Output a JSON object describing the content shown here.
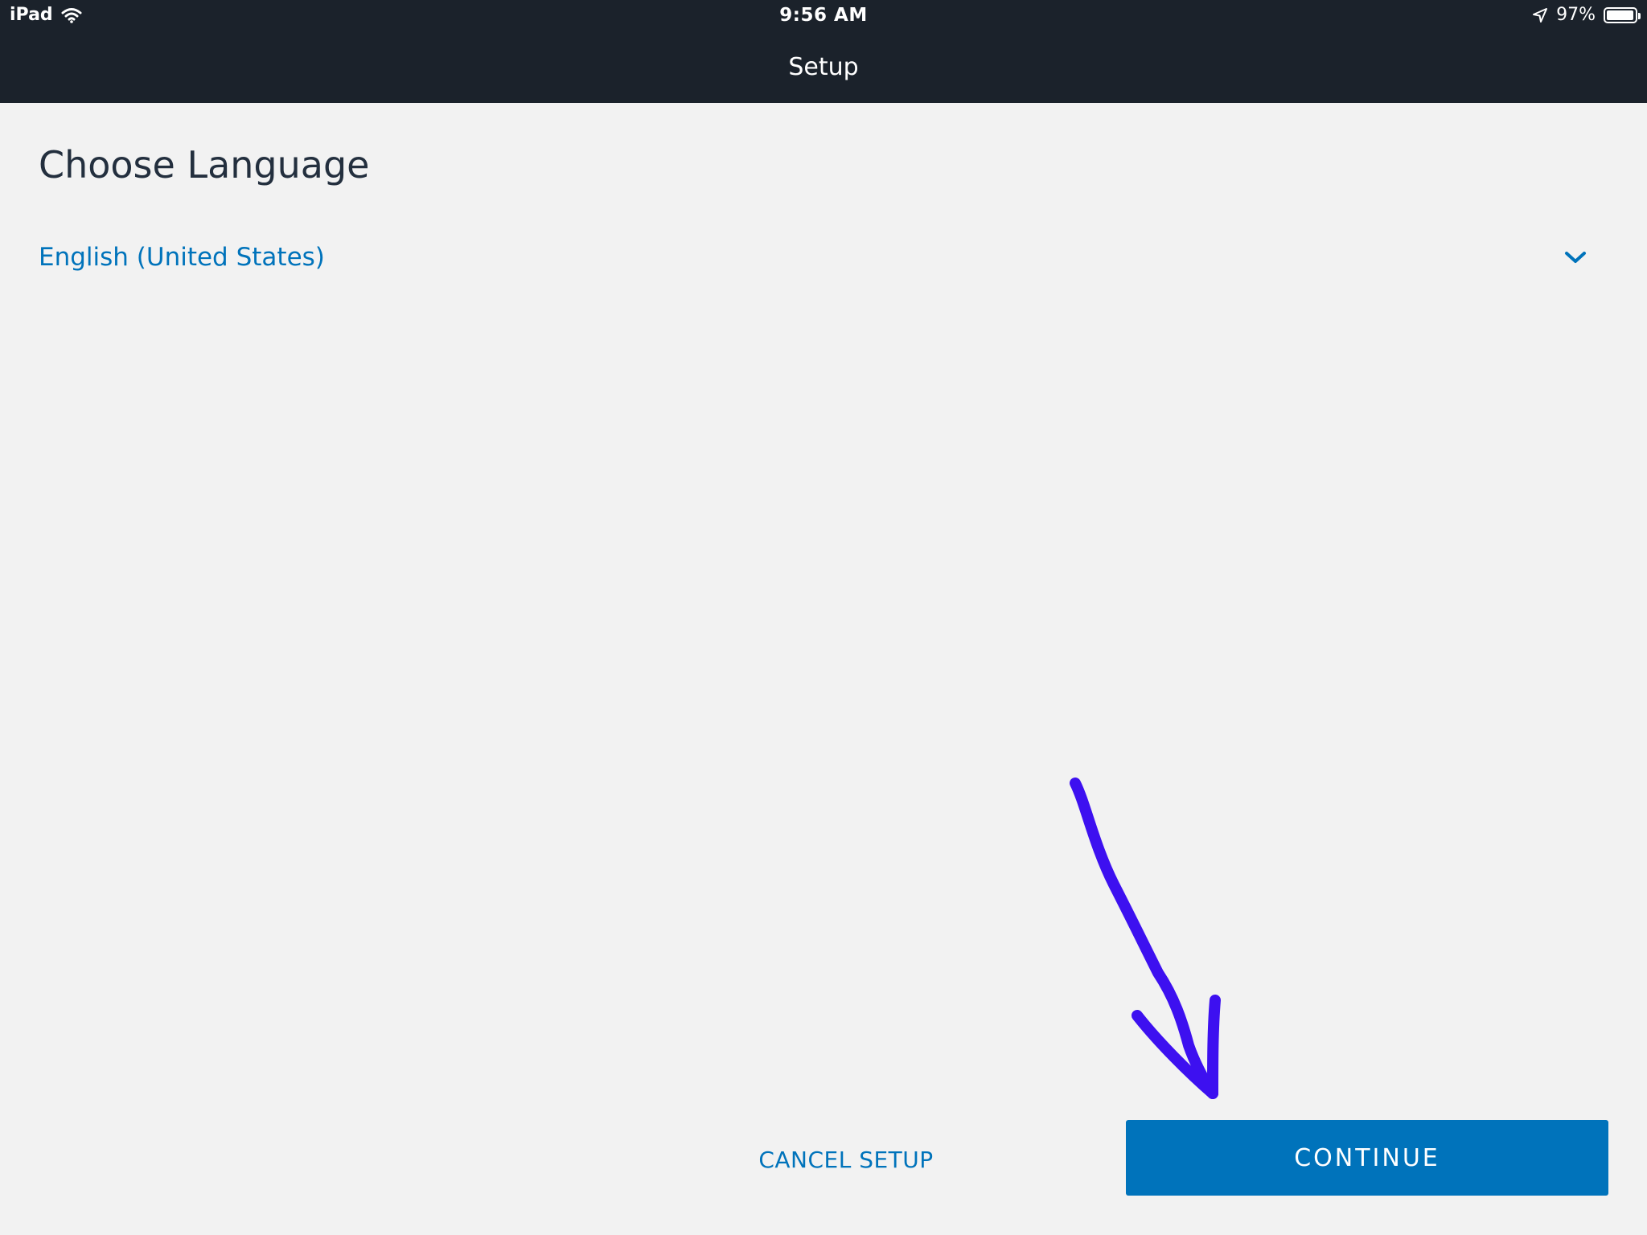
{
  "status_bar": {
    "device": "iPad",
    "time": "9:56 AM",
    "battery": "97%",
    "battery_level": 0.97,
    "icons": [
      "wifi-icon",
      "location-arrow-icon",
      "battery-icon"
    ]
  },
  "nav": {
    "title": "Setup"
  },
  "main": {
    "heading": "Choose Language",
    "language_select": {
      "selected": "English (United States)",
      "icon": "chevron-down-icon"
    }
  },
  "actions": {
    "cancel_label": "CANCEL SETUP",
    "continue_label": "CONTINUE"
  },
  "annotation": {
    "icon": "hand-drawn-arrow-icon",
    "color": "#3d10f0"
  },
  "colors": {
    "topbar": "#1b222b",
    "accent": "#0073bb",
    "background": "#f2f2f2",
    "heading": "#232f3e"
  }
}
